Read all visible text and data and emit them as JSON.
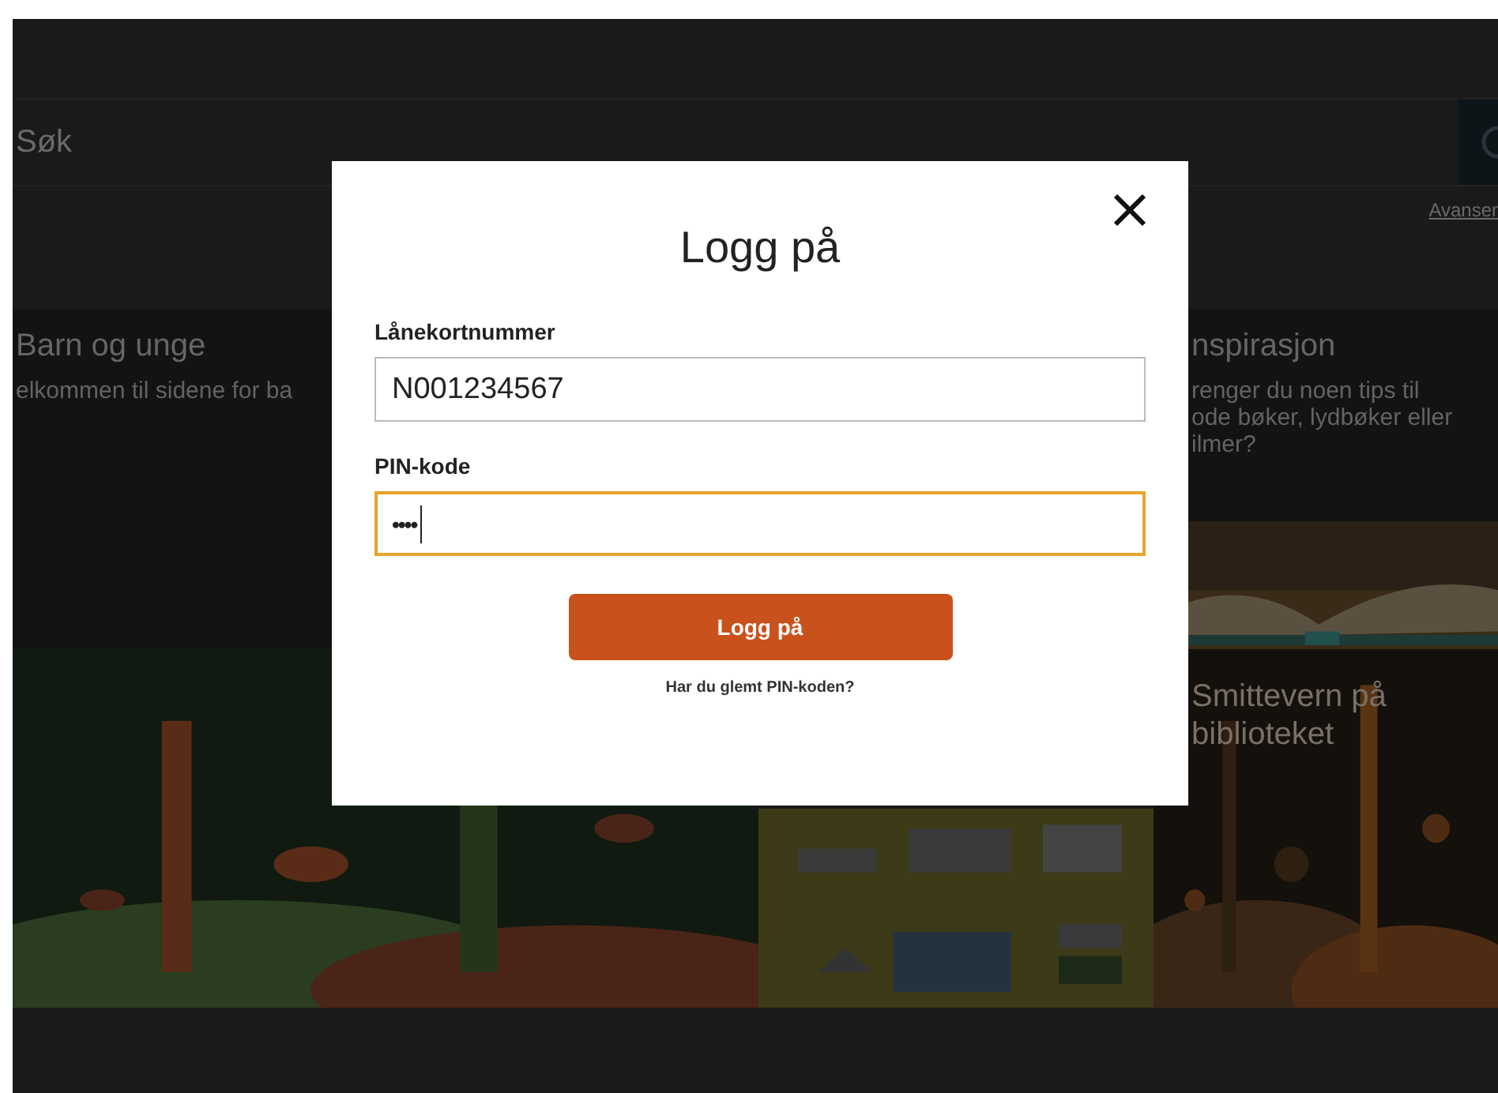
{
  "search": {
    "placeholder": "Søk"
  },
  "advanced_link": "Avanser",
  "tiles": [
    {
      "title": "Barn og unge",
      "lines": [
        "elkommen til sidene for ba"
      ]
    },
    {
      "title": "nspirasjon",
      "lines": [
        "renger du noen tips til",
        "ode bøker, lydbøker eller",
        "ilmer?"
      ]
    }
  ],
  "banners": [
    {
      "kind": "picture"
    },
    {
      "kind": "picture"
    },
    {
      "kind": "picture",
      "title_lines": [
        "Smittevern på",
        "biblioteket"
      ]
    }
  ],
  "dialog": {
    "title": "Logg på",
    "fields": [
      {
        "label": "Lånekortnummer",
        "value": "N001234567",
        "kind": "text",
        "focused": false
      },
      {
        "label": "PIN-kode",
        "value": "••••",
        "kind": "password",
        "focused": true
      }
    ],
    "button": "Logg på",
    "link": "Har du glemt PIN-koden?"
  }
}
